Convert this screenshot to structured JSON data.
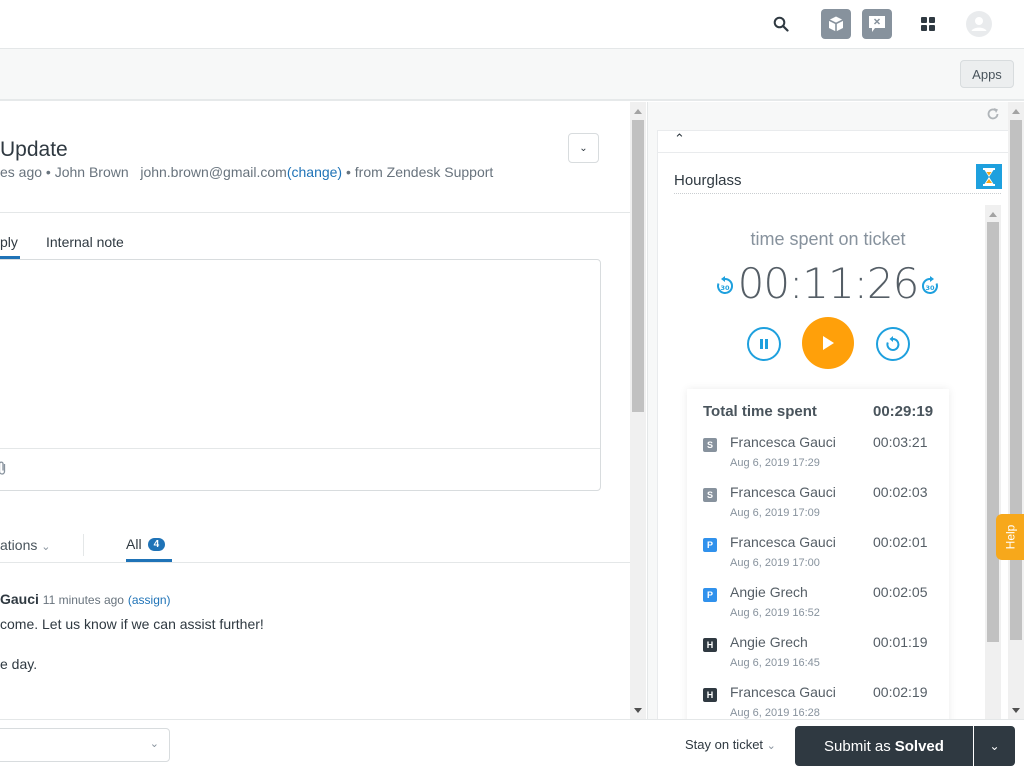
{
  "topbar": {
    "icons": [
      "search-icon",
      "cube-icon",
      "chat-close-icon",
      "apps-grid-icon",
      "avatar"
    ]
  },
  "subbar": {
    "apps_label": "Apps"
  },
  "ticket": {
    "title": "Update",
    "meta_prefix": "es ago • John Brown",
    "email": "john.brown@gmail.com",
    "change_link": "(change)",
    "meta_suffix": " • from Zendesk Support",
    "tabs": [
      {
        "label": "ply",
        "active": true
      },
      {
        "label": "Internal note",
        "active": false
      }
    ]
  },
  "conversation": {
    "filter_label": "ations",
    "all_label": "All",
    "all_count": "4",
    "comment": {
      "author": "Gauci",
      "time": "11 minutes ago",
      "assign": "(assign)",
      "lines": [
        "come. Let us know if we can assist further!",
        "e day."
      ]
    }
  },
  "app": {
    "name": "Hourglass",
    "timer_caption": "time spent on ticket",
    "timer_value": "00:11:26",
    "skip_back_label": "30",
    "skip_forward_label": "30",
    "total_label": "Total time spent",
    "total_value": "00:29:19",
    "entries": [
      {
        "badge": "S",
        "badge_color": "#87929d",
        "name": "Francesca Gauci",
        "date": "Aug 6, 2019 17:29",
        "duration": "00:03:21"
      },
      {
        "badge": "S",
        "badge_color": "#87929d",
        "name": "Francesca Gauci",
        "date": "Aug 6, 2019 17:09",
        "duration": "00:02:03"
      },
      {
        "badge": "P",
        "badge_color": "#3091ec",
        "name": "Francesca Gauci",
        "date": "Aug 6, 2019 17:00",
        "duration": "00:02:01"
      },
      {
        "badge": "P",
        "badge_color": "#3091ec",
        "name": "Angie Grech",
        "date": "Aug 6, 2019 16:52",
        "duration": "00:02:05"
      },
      {
        "badge": "H",
        "badge_color": "#2f3941",
        "name": "Angie Grech",
        "date": "Aug 6, 2019 16:45",
        "duration": "00:01:19"
      },
      {
        "badge": "H",
        "badge_color": "#2f3941",
        "name": "Francesca Gauci",
        "date": "Aug 6, 2019 16:28",
        "duration": "00:02:19"
      }
    ]
  },
  "help_label": "Help",
  "footer": {
    "stay_label": "Stay on ticket",
    "submit_prefix": "Submit as",
    "submit_status": "Solved"
  },
  "colors": {
    "accent": "#1f73b7",
    "timer_orange": "#ffa00a",
    "timer_blue": "#1ea0de",
    "submit_bg": "#2f3941",
    "help_orange": "#f7a81b"
  }
}
